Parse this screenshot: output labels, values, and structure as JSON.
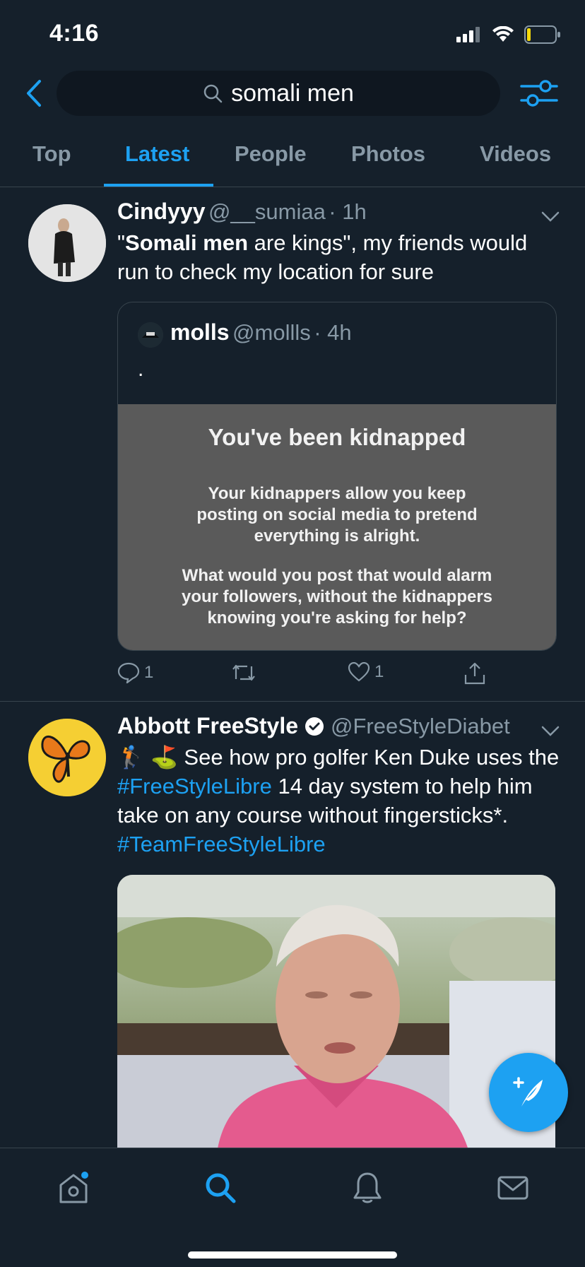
{
  "status_bar": {
    "time": "4:16"
  },
  "search": {
    "query": "somali men"
  },
  "tabs": [
    {
      "label": "Top"
    },
    {
      "label": "Latest"
    },
    {
      "label": "People"
    },
    {
      "label": "Photos"
    },
    {
      "label": "Videos"
    }
  ],
  "active_tab": "Latest",
  "tweets": [
    {
      "name": "Cindyyy",
      "handle": "@__sumiaa",
      "time": "· 1h",
      "text_part1": "\"",
      "text_bold": "Somali men",
      "text_part2": " are kings\", my friends would run to check my location for sure",
      "quote": {
        "name": "molls",
        "handle": "@mollls",
        "time": "· 4h",
        "text": ".",
        "image_title": "You've been kidnapped",
        "image_body1": "Your kidnappers allow you keep posting on social media to pretend everything is alright.",
        "image_body2": "What would you post that would alarm your followers, without the kidnappers knowing you're asking for help?"
      },
      "replies": "1",
      "retweets": "",
      "likes": "1"
    },
    {
      "name": "Abbott FreeStyle",
      "handle": "@FreeStyleDiabet",
      "emoji": "🏌 ⛳",
      "text_a": " See how pro golfer Ken Duke uses the ",
      "hashtag1": "#FreeStyleLibre",
      "text_b": " 14 day system to help him take on any course without fingersticks*. ",
      "hashtag2": "#TeamFreeStyleLibre"
    }
  ],
  "colors": {
    "background": "#15202b",
    "accent": "#1da1f2",
    "secondary_text": "#8899a6",
    "divider": "#38444d"
  },
  "icons": {
    "back": "chevron-left-icon",
    "search": "search-icon",
    "filter": "sliders-icon",
    "compose": "compose-tweet-icon",
    "nav": [
      "home-icon",
      "search-icon",
      "notifications-bell-icon",
      "messages-envelope-icon"
    ]
  }
}
